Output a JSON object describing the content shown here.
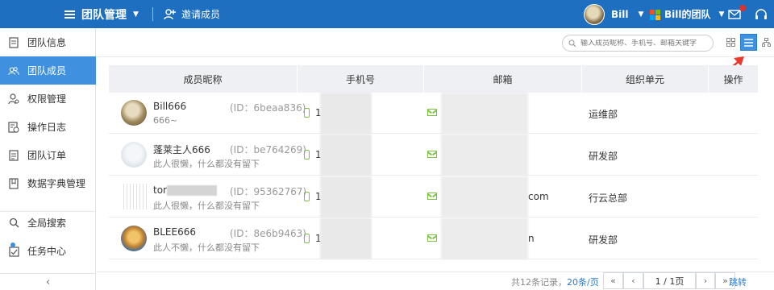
{
  "header": {
    "title": "团队管理",
    "invite_label": "邀请成员",
    "user_name": "Bill",
    "team_name": "Bill的团队"
  },
  "sidebar": {
    "items": [
      {
        "label": "团队信息",
        "icon": "doc-icon"
      },
      {
        "label": "团队成员",
        "icon": "members-icon",
        "active": true
      },
      {
        "label": "权限管理",
        "icon": "permission-icon"
      },
      {
        "label": "操作日志",
        "icon": "log-icon"
      },
      {
        "label": "团队订单",
        "icon": "order-icon"
      },
      {
        "label": "数据字典管理",
        "icon": "dictionary-icon"
      },
      {
        "label": "全局搜索",
        "icon": "search-icon"
      },
      {
        "label": "任务中心",
        "icon": "task-icon"
      }
    ],
    "collapse_symbol": "‹"
  },
  "toolbar": {
    "search_placeholder": "输入成员昵称、手机号、邮箱关键字"
  },
  "table": {
    "columns": [
      "成员昵称",
      "手机号",
      "邮箱",
      "组织单元",
      "操作"
    ],
    "rows": [
      {
        "nickname": "Bill666",
        "id": "(ID：6beaa836)",
        "desc": "666~",
        "phone": "1",
        "email_suffix": "",
        "org": "运维部"
      },
      {
        "nickname": "蓬莱主人666",
        "id": "(ID：be764269)",
        "desc": "此人很懒，什么都没有留下",
        "phone": "1",
        "email_suffix": "",
        "org": "研发部"
      },
      {
        "nickname": "tor",
        "id": "(ID：95362767)",
        "desc": "此人很懒，什么都没有留下",
        "phone": "1",
        "email_suffix": "com",
        "org": "行云总部"
      },
      {
        "nickname": "BLEE666",
        "id": "(ID：8e6b9463)",
        "desc": "此人不懒，什么都没有留下",
        "phone": "1",
        "email_suffix": "n",
        "org": "研发部"
      }
    ]
  },
  "pagination": {
    "total_text": "共12条记录，",
    "per_page": "20条/页",
    "first": "«",
    "prev": "‹",
    "page_text": "1 / 1页",
    "next": "›",
    "last": "»",
    "jump": "跳转"
  },
  "colors": {
    "header_bg": "#1e6fbf",
    "active": "#4090e0",
    "icon_green": "#7cc242",
    "annotation_red": "#e83a2f"
  }
}
